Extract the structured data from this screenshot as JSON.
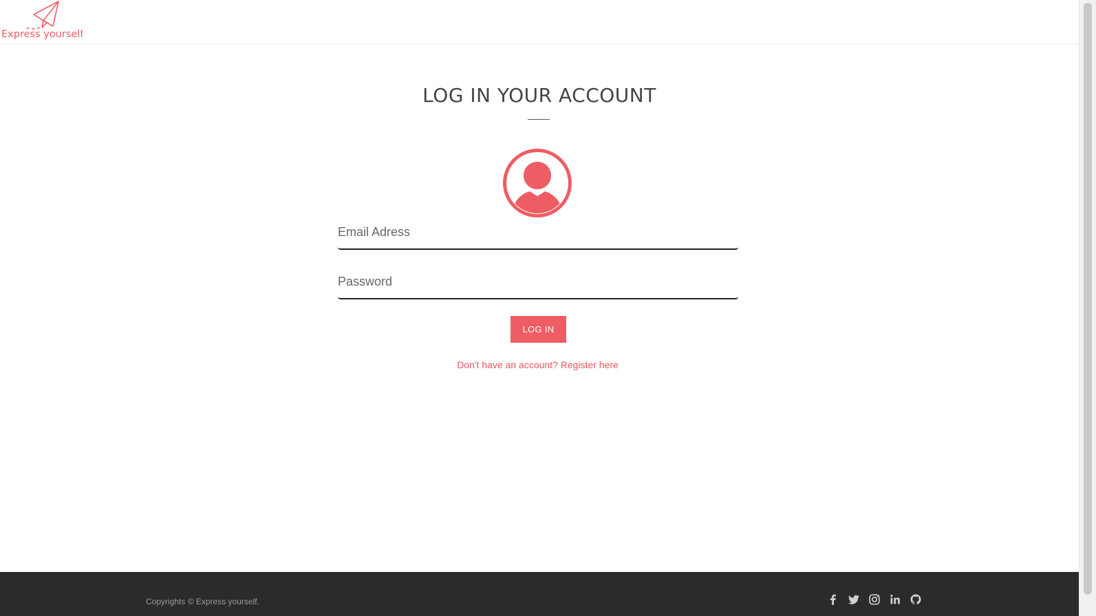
{
  "brand": {
    "logo_text": "Express yourself",
    "accent_color": "#ee5d63"
  },
  "main": {
    "title": "LOG IN YOUR ACCOUNT",
    "avatar_icon": "user-circle-icon",
    "email": {
      "value": "",
      "placeholder": "Email Adress"
    },
    "password": {
      "value": "",
      "placeholder": "Password"
    },
    "login_button_label": "LOG IN",
    "register_link_label": "Don't have an account? Register here"
  },
  "footer": {
    "copyright": "Copyrights © Express yourself.",
    "background_color": "#2b2b2b",
    "social_icons": [
      "facebook-icon",
      "twitter-icon",
      "instagram-icon",
      "linkedin-icon",
      "github-icon"
    ]
  }
}
